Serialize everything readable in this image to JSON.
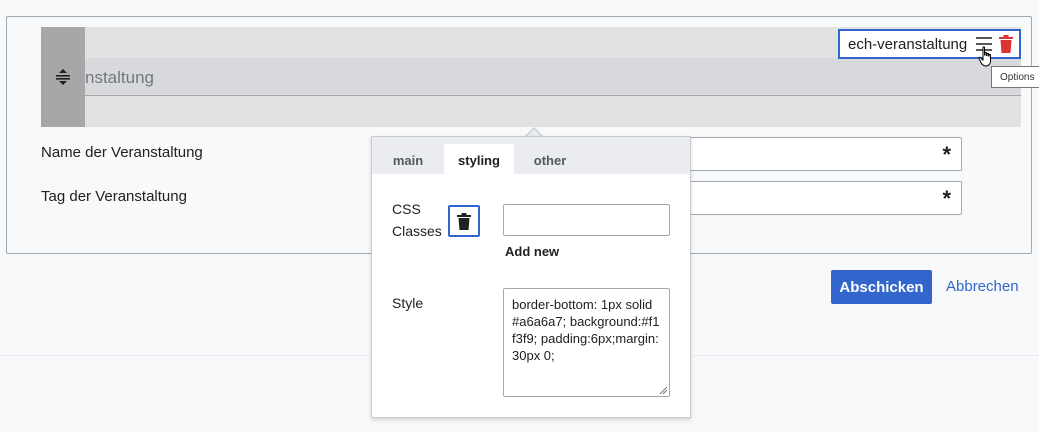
{
  "section": {
    "title": "nstaltung"
  },
  "element_tag": {
    "label": "ech-veranstaltung",
    "tooltip": "Options"
  },
  "form": {
    "fields": [
      {
        "label": "Name der Veranstaltung",
        "required_marker": "*"
      },
      {
        "label": "Tag der Veranstaltung",
        "required_marker": "*"
      }
    ],
    "submit_label": "Abschicken",
    "cancel_label": "Abbrechen"
  },
  "popup": {
    "tabs": [
      {
        "label": "main",
        "active": false
      },
      {
        "label": "styling",
        "active": true
      },
      {
        "label": "other",
        "active": false
      }
    ],
    "css_classes": {
      "label_line1": "CSS",
      "label_line2": "Classes",
      "input_value": "",
      "add_label": "Add new"
    },
    "style": {
      "label": "Style",
      "value": "border-bottom: 1px solid #a6a6a7; background:#f1f3f9; padding:6px;margin:30px 0;"
    }
  },
  "colors": {
    "accent": "#3366cc",
    "delete": "#d33",
    "handle": "#a7a7a7"
  },
  "icons": {
    "drag": "drag-handle-icon",
    "menu": "menu-icon",
    "trash": "trash-icon",
    "pointer": "hand-pointer-icon"
  }
}
